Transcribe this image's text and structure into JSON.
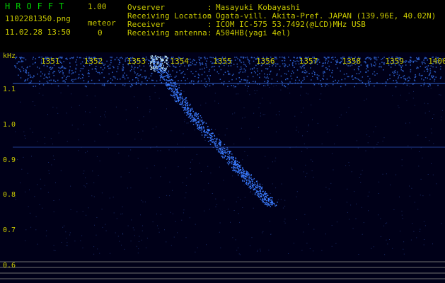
{
  "app": {
    "title": "HROFFT",
    "version": "1.00"
  },
  "file_name": "1102281350.png",
  "timestamp": "11.02.28 13:50",
  "meteor": {
    "label": "meteor",
    "count": "0"
  },
  "info": [
    {
      "key": "Ovserver",
      "value": "Masayuki Kobayashi"
    },
    {
      "key": "Receiving Location",
      "value": "Ogata-vill. Akita-Pref. JAPAN (139.96E, 40.02N)"
    },
    {
      "key": "Receiver",
      "value": "ICOM IC-575 53.7492(@LCD)MHz USB"
    },
    {
      "key": "Receiving antenna",
      "value": "A504HB(yagi 4el)"
    }
  ],
  "separator": ":",
  "chart_data": {
    "type": "heatmap",
    "ylabel": "kHz",
    "x_ticks": [
      "1351",
      "1352",
      "1353",
      "1354",
      "1355",
      "1356",
      "1357",
      "1358",
      "1359",
      "1400"
    ],
    "y_ticks": [
      "1.1",
      "1.0",
      "0.9",
      "0.8",
      "0.7",
      "0.6"
    ],
    "ylim": [
      0.58,
      1.2
    ],
    "colors": {
      "background": "#000020",
      "signal": "#3a7bff",
      "hot": "#bfe8ff",
      "label": "#c8c800",
      "title": "#00d000"
    },
    "meteor_trace": {
      "start_time": "1353.6",
      "end_time": "1356.6",
      "start_khz": 1.19,
      "end_khz": 0.77
    }
  }
}
